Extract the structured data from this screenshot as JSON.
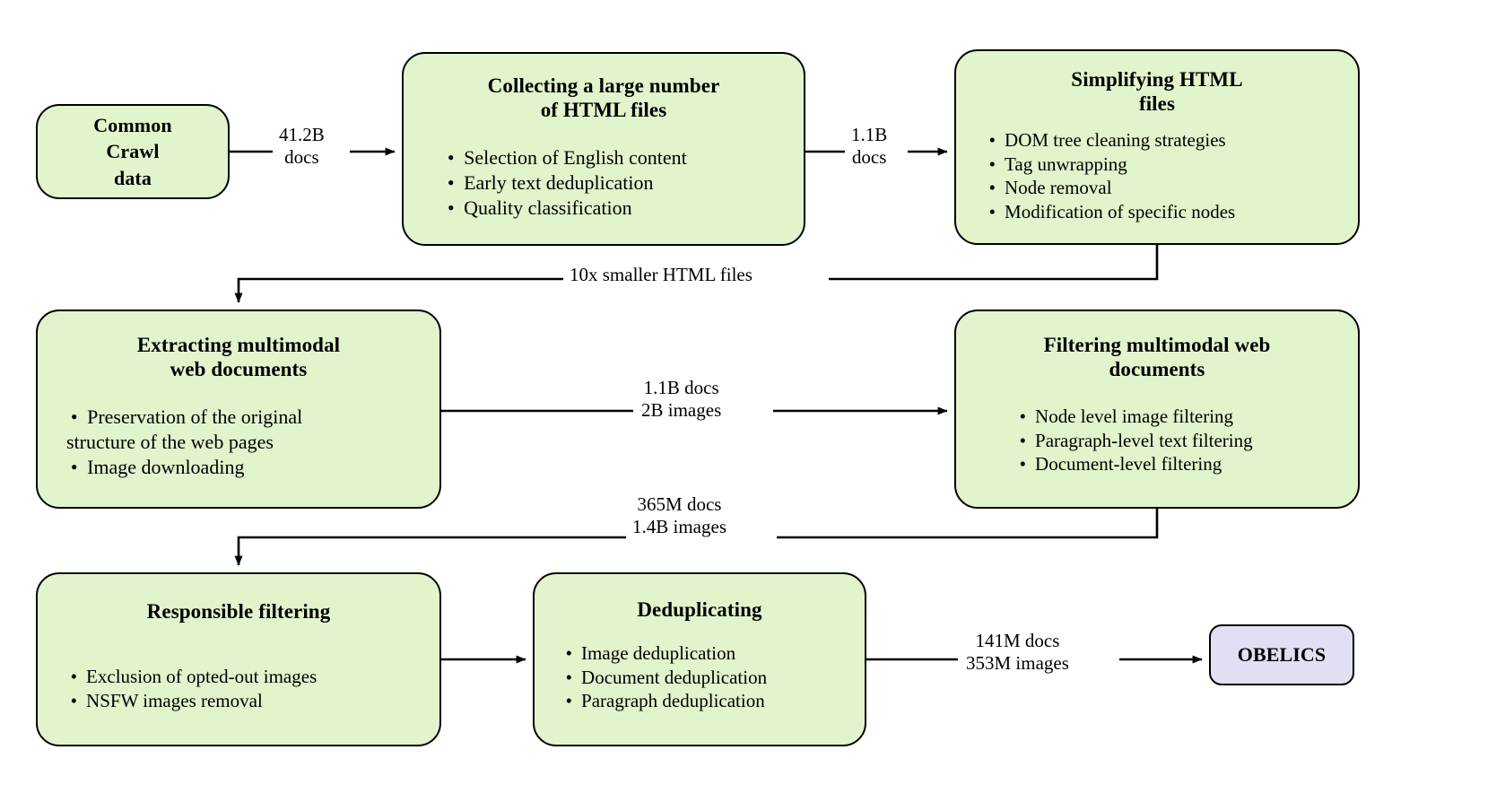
{
  "diagram": {
    "title": "OBELICS dataset construction pipeline",
    "colors": {
      "process_fill": "#e1f4cc",
      "terminal_fill": "#e0e0f5",
      "stroke": "#000000",
      "background": "#ffffff"
    }
  },
  "nodes": {
    "common_crawl": {
      "title": "Common\nCrawl\ndata",
      "line1": "Common",
      "line2": "Crawl",
      "line3": "data",
      "bullets": []
    },
    "collecting": {
      "line1": "Collecting a large number",
      "line2": "of HTML files",
      "bullets": [
        "Selection of English content",
        "Early text deduplication",
        "Quality classification"
      ]
    },
    "simplifying": {
      "line1": "Simplifying HTML",
      "line2": "files",
      "bullets": [
        "DOM tree cleaning strategies",
        "Tag unwrapping",
        "Node removal",
        "Modification of specific nodes"
      ]
    },
    "extracting": {
      "line1": "Extracting multimodal",
      "line2": "web documents",
      "bullets_first_line": "Preservation of the original",
      "bullets_first_line_cont": "structure of the web pages",
      "bullets": [
        "Image downloading"
      ]
    },
    "filtering": {
      "line1": "Filtering multimodal web",
      "line2": "documents",
      "bullets": [
        "Node level image filtering",
        "Paragraph-level text filtering",
        "Document-level filtering"
      ]
    },
    "responsible": {
      "line1": "Responsible filtering",
      "line2": "",
      "bullets": [
        "Exclusion of opted-out images",
        "NSFW images removal"
      ]
    },
    "deduplicating": {
      "line1": "Deduplicating",
      "line2": "",
      "bullets": [
        "Image deduplication",
        "Document deduplication",
        "Paragraph deduplication"
      ]
    },
    "obelics": {
      "label": "OBELICS"
    }
  },
  "edges": {
    "crawl_to_collecting": {
      "line1": "41.2B",
      "line2": "docs"
    },
    "collecting_to_simplifying": {
      "line1": "1.1B",
      "line2": "docs"
    },
    "simplifying_to_extracting": {
      "line1": "10x smaller HTML files",
      "line2": ""
    },
    "extracting_to_filtering": {
      "line1": "1.1B docs",
      "line2": "2B images"
    },
    "filtering_to_responsible": {
      "line1": "365M docs",
      "line2": "1.4B images"
    },
    "dedup_to_obelics": {
      "line1": "141M docs",
      "line2": "353M images"
    }
  },
  "bullet_glyph": "•"
}
